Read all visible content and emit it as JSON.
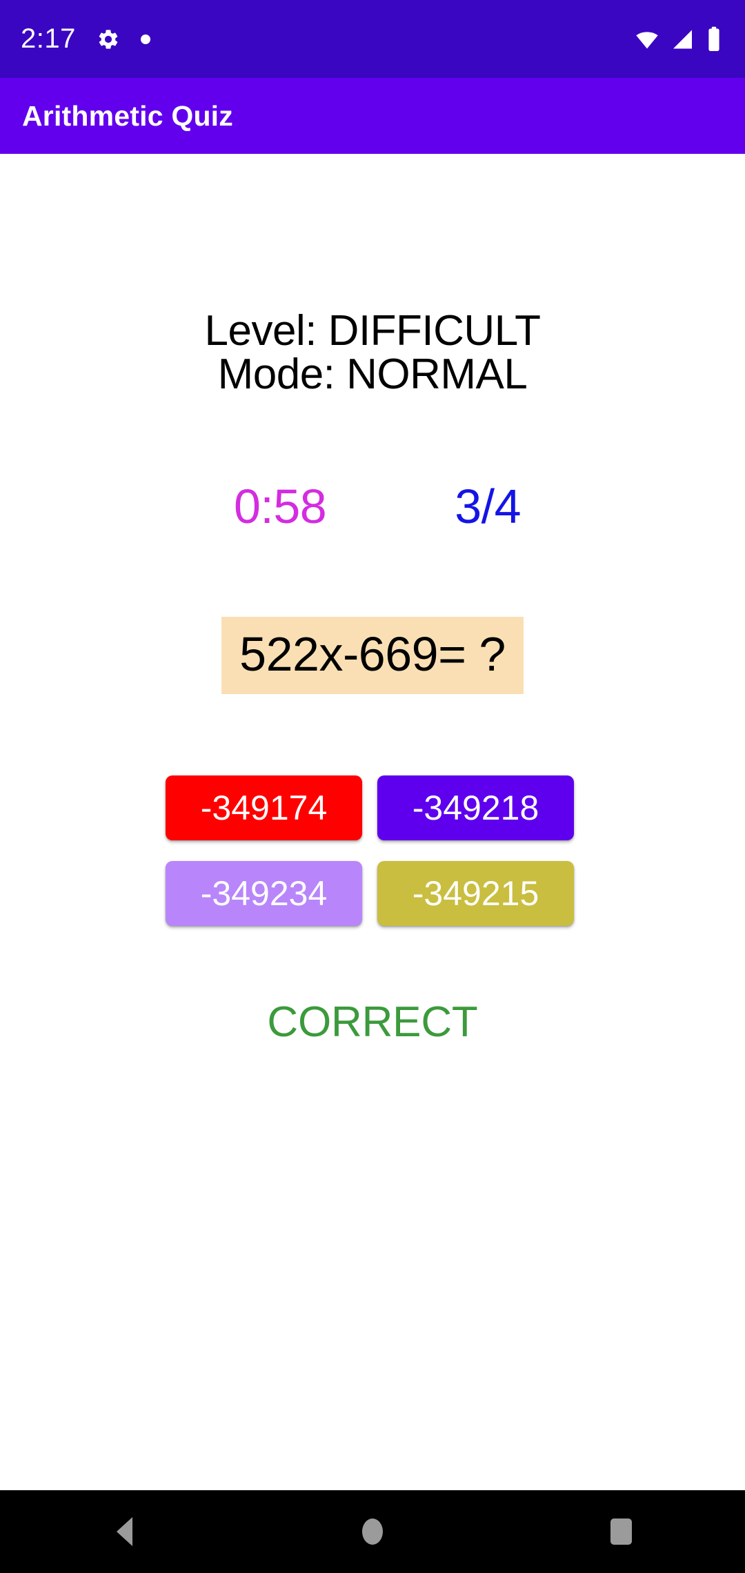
{
  "status_bar": {
    "time": "2:17",
    "icons": [
      "gear-icon",
      "dot-icon",
      "wifi-icon",
      "signal-icon",
      "battery-icon"
    ],
    "background_color": "#3B06C2"
  },
  "app_bar": {
    "title": "Arithmetic Quiz",
    "background_color": "#6200EE",
    "text_color": "#FFFFFF"
  },
  "quiz": {
    "level_line": "Level: DIFFICULT",
    "mode_line": "Mode: NORMAL",
    "timer": "0:58",
    "timer_color": "#D42CE0",
    "score": "3/4",
    "score_color": "#1414E6",
    "question": "522x-669= ?",
    "question_background": "#FADFB5",
    "options": [
      {
        "label": "-349174",
        "color": "#FF0000",
        "text_color": "#FFFFFF"
      },
      {
        "label": "-349218",
        "color": "#5E00EE",
        "text_color": "#FFFFFF"
      },
      {
        "label": "-349234",
        "color": "#B886FA",
        "text_color": "#FFFFFF"
      },
      {
        "label": "-349215",
        "color": "#C9BE40",
        "text_color": "#FFFFFF"
      }
    ],
    "feedback": "CORRECT",
    "feedback_color": "#3C9A3C"
  },
  "nav_bar": {
    "back_label": "Back",
    "home_label": "Home",
    "recents_label": "Recents",
    "background_color": "#000000",
    "icon_color": "#9B9B9B"
  }
}
